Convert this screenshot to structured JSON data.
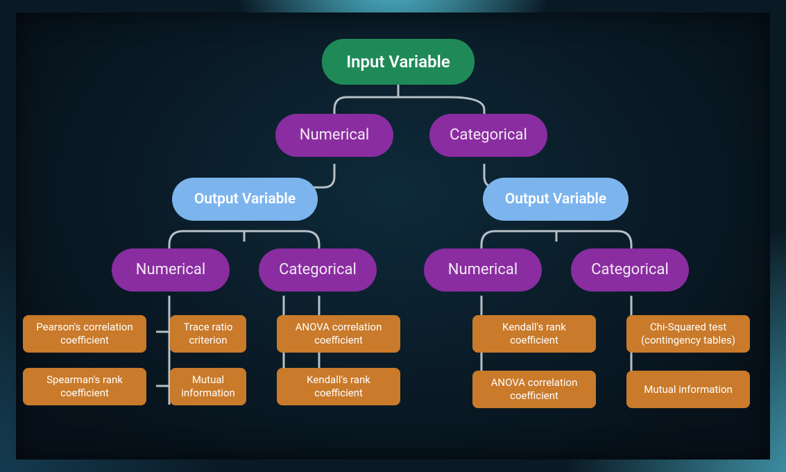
{
  "root": "Input Variable",
  "branch_left": {
    "label": "Numerical",
    "output_label": "Output Variable",
    "left": {
      "label": "Numerical",
      "leaves": [
        "Pearson's correlation coefficient",
        "Spearman's rank coefficient",
        "Trace ratio criterion",
        "Mutual information"
      ]
    },
    "right": {
      "label": "Categorical",
      "leaves": [
        "ANOVA correlation coefficient",
        "Kendall's rank coefficient"
      ]
    }
  },
  "branch_right": {
    "label": "Categorical",
    "output_label": "Output Variable",
    "left": {
      "label": "Numerical",
      "leaves": [
        "Kendall's rank coefficient",
        "ANOVA correlation coefficient"
      ]
    },
    "right": {
      "label": "Categorical",
      "leaves": [
        "Chi-Squared test (contingency tables)",
        "Mutual information"
      ]
    }
  },
  "colors": {
    "root": "#1f8a58",
    "category": "#8a2da0",
    "output": "#7cb4ee",
    "leaf": "#c97a2a",
    "connector": "#b7c0c6"
  }
}
